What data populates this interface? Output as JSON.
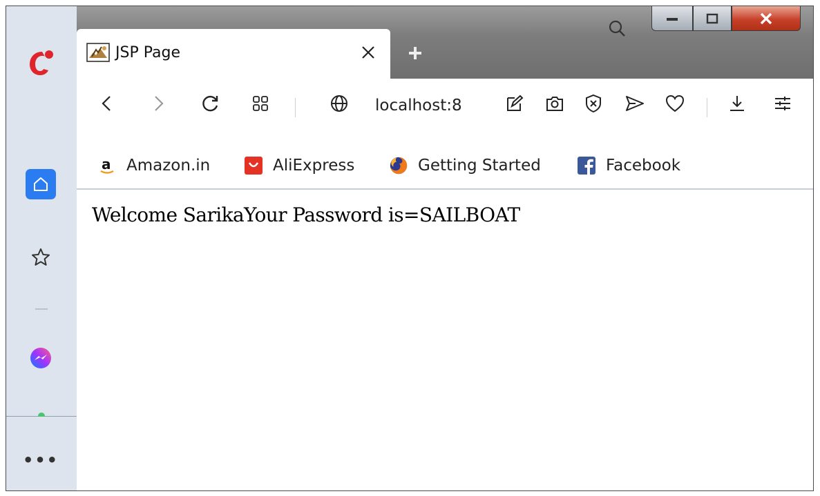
{
  "tab": {
    "title": "JSP Page",
    "favicon": "java-duke-icon",
    "close_icon": "close-icon"
  },
  "new_tab_icon": "plus-icon",
  "window": {
    "search_icon": "search-icon",
    "minimize_icon": "minimize-icon",
    "maximize_icon": "maximize-icon",
    "close_icon": "close-x-icon"
  },
  "sidebar": {
    "logo": "opera-gx-logo",
    "items": [
      {
        "icon": "home-icon",
        "active": true
      },
      {
        "icon": "star-icon",
        "active": false
      },
      {
        "icon": "messenger-icon",
        "active": false
      },
      {
        "icon": "more-dots-icon",
        "label": "•••"
      }
    ]
  },
  "toolbar": {
    "url": "localhost:8",
    "icons": [
      "back-icon",
      "forward-icon",
      "reload-icon",
      "tabs-grid-icon",
      "globe-icon",
      "edit-icon",
      "camera-icon",
      "block-icon",
      "send-icon",
      "heart-icon",
      "download-icon",
      "settings-sliders-icon"
    ]
  },
  "bookmarks": [
    {
      "label": "Amazon.in",
      "icon": "amazon-icon"
    },
    {
      "label": "AliExpress",
      "icon": "aliexpress-icon"
    },
    {
      "label": "Getting Started",
      "icon": "firefox-icon"
    },
    {
      "label": "Facebook",
      "icon": "facebook-icon"
    }
  ],
  "page": {
    "text": "Welcome SarikaYour Password is=SAILBOAT"
  },
  "colors": {
    "accent": "#2b7cf0",
    "opera_red": "#e0242c",
    "close_button": "#c8412a",
    "sidebar_bg": "#dde4ed"
  }
}
